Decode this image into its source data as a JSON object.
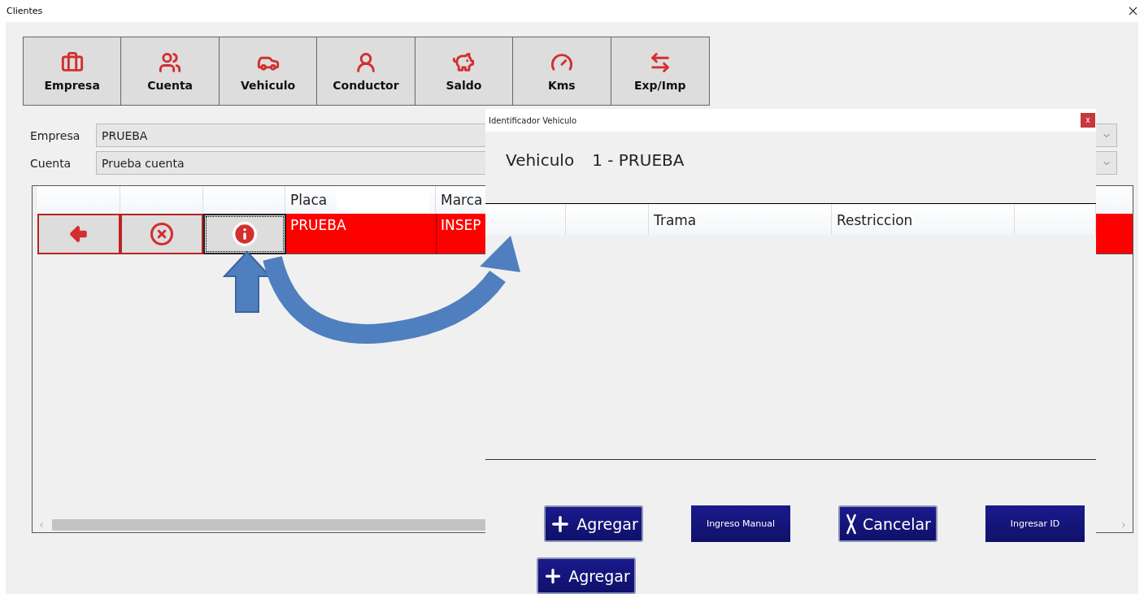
{
  "window": {
    "title": "Clientes"
  },
  "toolbar": [
    {
      "label": "Empresa"
    },
    {
      "label": "Cuenta"
    },
    {
      "label": "Vehiculo"
    },
    {
      "label": "Conductor"
    },
    {
      "label": "Saldo"
    },
    {
      "label": "Kms"
    },
    {
      "label": "Exp/Imp"
    }
  ],
  "filters": [
    {
      "label": "Empresa",
      "value": "PRUEBA"
    },
    {
      "label": "Cuenta",
      "value": "Prueba cuenta"
    }
  ],
  "grid": {
    "columns": [
      "Placa",
      "Marca"
    ],
    "rows": [
      {
        "placa": "PRUEBA",
        "marca": "INSEP",
        "selected": true
      }
    ]
  },
  "add_button": "Agregar",
  "dialog": {
    "title": "Identificador Vehiculo",
    "close": "x",
    "vehicle_label": "Vehiculo",
    "vehicle_value": "1 - PRUEBA",
    "columns": [
      "Trama",
      "Restriccion"
    ],
    "buttons": [
      {
        "label": "Agregar",
        "kind": "plus"
      },
      {
        "label": "Ingreso Manual",
        "kind": "small"
      },
      {
        "label": "Cancelar",
        "kind": "cross"
      },
      {
        "label": "Ingresar ID",
        "kind": "small"
      }
    ]
  }
}
